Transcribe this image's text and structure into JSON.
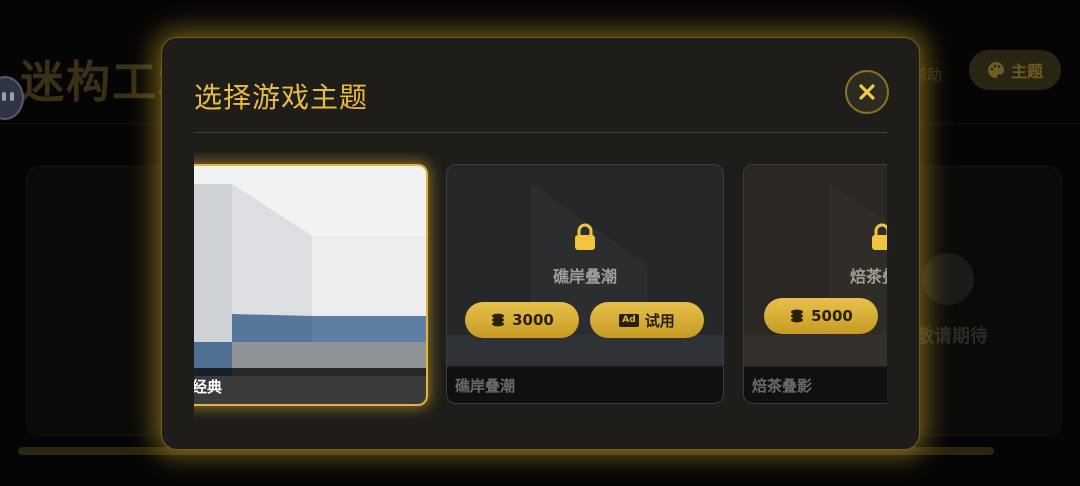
{
  "background": {
    "title": "迷构工坊",
    "theme_button_label": "主题",
    "help_text": "帮助",
    "coming_soon_text": "敬请期待"
  },
  "modal": {
    "title": "选择游戏主题",
    "close_icon": "close-icon"
  },
  "themes": [
    {
      "name": "经典",
      "caption": "经典",
      "locked": false,
      "selected": true
    },
    {
      "name": "礁岸叠潮",
      "caption": "礁岸叠潮",
      "locked": true,
      "price": "3000",
      "trial_label": "试用",
      "ad_badge": "Ad"
    },
    {
      "name": "焙茶叠影",
      "caption": "焙茶叠影",
      "lock_label": "焙茶叠",
      "locked": true,
      "price": "5000"
    }
  ],
  "colors": {
    "accent": "#e8bc40",
    "modal_bg": "#1f1d19",
    "glow": "#cda528",
    "pill": "#d4ab33"
  }
}
